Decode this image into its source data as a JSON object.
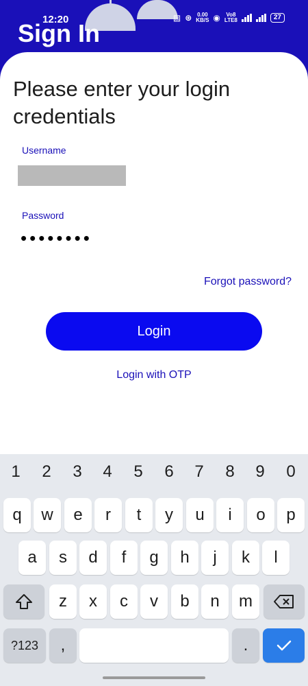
{
  "status_bar": {
    "time": "12:20",
    "net_speed_top": "0.00",
    "net_speed_bottom": "KB/S",
    "volte_top": "Vo8",
    "volte_bottom": "LTE8",
    "battery": "27"
  },
  "header": {
    "title": "Sign In"
  },
  "form": {
    "heading": "Please enter your login credentials",
    "username_label": "Username",
    "password_label": "Password",
    "password_value": "••••••••",
    "forgot_password": "Forgot password?",
    "login_button": "Login",
    "otp_link": "Login with OTP"
  },
  "keyboard": {
    "numbers": [
      "1",
      "2",
      "3",
      "4",
      "5",
      "6",
      "7",
      "8",
      "9",
      "0"
    ],
    "row1": [
      "q",
      "w",
      "e",
      "r",
      "t",
      "y",
      "u",
      "i",
      "o",
      "p"
    ],
    "row2": [
      "a",
      "s",
      "d",
      "f",
      "g",
      "h",
      "j",
      "k",
      "l"
    ],
    "row3": [
      "z",
      "x",
      "c",
      "v",
      "b",
      "n",
      "m"
    ],
    "symbols_key": "?123",
    "comma_key": ",",
    "period_key": "."
  },
  "colors": {
    "brand": "#1a10b8",
    "button": "#0a0af0",
    "keyboard_bg": "#e6e9ee",
    "enter_key": "#2b7de8"
  }
}
